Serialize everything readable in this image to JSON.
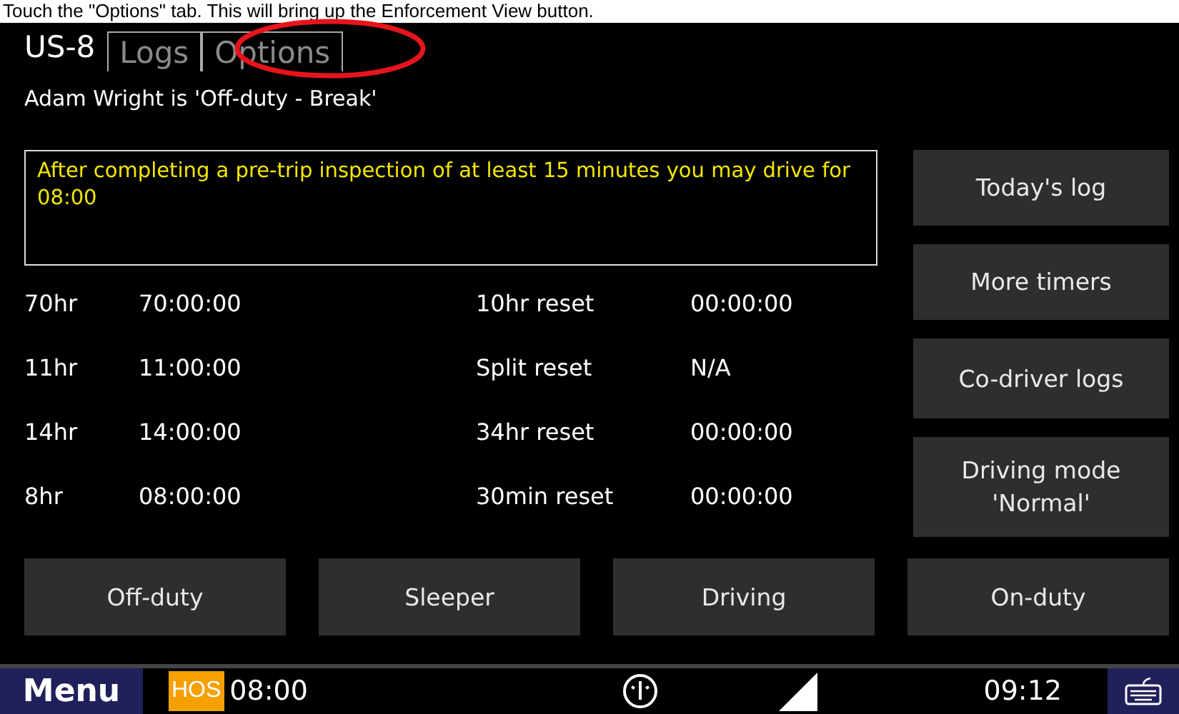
{
  "caption": "Touch the \"Options\" tab. This will bring up the Enforcement View button.",
  "tabs": [
    {
      "label": "US-8",
      "selected": true
    },
    {
      "label": "Logs",
      "selected": false
    },
    {
      "label": "Options",
      "selected": false
    }
  ],
  "status": "Adam Wright is 'Off-duty - Break'",
  "message": "After completing a pre-trip inspection of at least 15 minutes you may drive for 08:00",
  "timers": [
    {
      "label": "70hr",
      "value": "70:00:00",
      "reset_label": "10hr reset",
      "reset_value": "00:00:00"
    },
    {
      "label": "11hr",
      "value": "11:00:00",
      "reset_label": "Split reset",
      "reset_value": "N/A"
    },
    {
      "label": "14hr",
      "value": "14:00:00",
      "reset_label": "34hr reset",
      "reset_value": "00:00:00"
    },
    {
      "label": "8hr",
      "value": "08:00:00",
      "reset_label": "30min reset",
      "reset_value": "00:00:00"
    }
  ],
  "side_buttons": [
    "Today's log",
    "More timers",
    "Co-driver logs",
    "Driving mode 'Normal'"
  ],
  "duty_buttons": [
    "Off-duty",
    "Sleeper",
    "Driving",
    "On-duty"
  ],
  "taskbar": {
    "menu": "Menu",
    "hos_badge": "HOS",
    "hos_time": "08:00",
    "clock": "09:12"
  }
}
